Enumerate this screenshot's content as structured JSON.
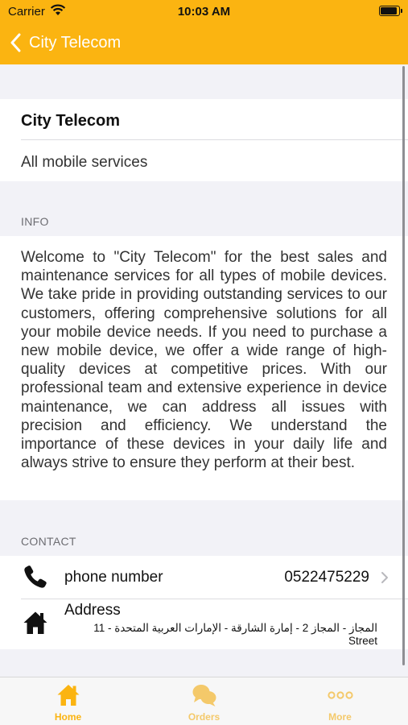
{
  "status_bar": {
    "carrier": "Carrier",
    "time": "10:03 AM"
  },
  "navbar": {
    "back_label": "City Telecom"
  },
  "header_card": {
    "title": "City Telecom",
    "subtitle": "All mobile services"
  },
  "info": {
    "section_title": "INFO",
    "text": "Welcome to \"City Telecom\" for the best sales and maintenance services for all types of mobile devices. We take pride in providing outstanding services to our customers, offering comprehensive solutions for all your mobile device needs. If you need to purchase a new mobile device, we offer a wide range of high-quality devices at competitive prices. With our professional team and extensive experience in device maintenance, we can address all issues with precision and efficiency. We understand the importance of these devices in your daily life and always strive to ensure they perform at their best."
  },
  "contact": {
    "section_title": "CONTACT",
    "phone": {
      "label": "phone number",
      "value": "0522475229",
      "icon": "phone-icon"
    },
    "address": {
      "label": "Address",
      "value": "المجاز - المجاز 2 - إمارة الشارقة - الإمارات العربية المتحدة - 11 Street",
      "icon": "home-icon"
    }
  },
  "tabbar": {
    "tabs": [
      {
        "label": "Home",
        "icon": "home-icon",
        "active": true
      },
      {
        "label": "Orders",
        "icon": "chat-bubbles-icon",
        "active": false
      },
      {
        "label": "More",
        "icon": "more-dots-icon",
        "active": false
      }
    ]
  },
  "colors": {
    "accent": "#fbb411",
    "inactive_tab": "#f4c96a",
    "background": "#f2f2f7",
    "separator": "#dcdce0",
    "section_header": "#6d6d72"
  }
}
